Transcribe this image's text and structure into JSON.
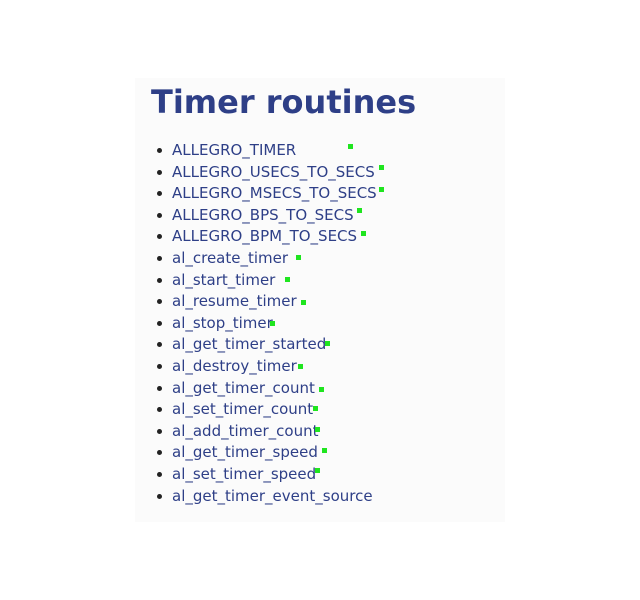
{
  "title": "Timer routines",
  "items": [
    {
      "label": "ALLEGRO_TIMER",
      "marked": true
    },
    {
      "label": "ALLEGRO_USECS_TO_SECS",
      "marked": true
    },
    {
      "label": "ALLEGRO_MSECS_TO_SECS",
      "marked": true
    },
    {
      "label": "ALLEGRO_BPS_TO_SECS",
      "marked": true
    },
    {
      "label": "ALLEGRO_BPM_TO_SECS",
      "marked": true
    },
    {
      "label": "al_create_timer",
      "marked": true
    },
    {
      "label": "al_start_timer",
      "marked": true
    },
    {
      "label": "al_resume_timer",
      "marked": true
    },
    {
      "label": "al_stop_timer",
      "marked": true
    },
    {
      "label": "al_get_timer_started",
      "marked": true
    },
    {
      "label": "al_destroy_timer",
      "marked": true
    },
    {
      "label": "al_get_timer_count",
      "marked": true
    },
    {
      "label": "al_set_timer_count",
      "marked": true
    },
    {
      "label": "al_add_timer_count",
      "marked": true
    },
    {
      "label": "al_get_timer_speed",
      "marked": true
    },
    {
      "label": "al_set_timer_speed",
      "marked": true
    },
    {
      "label": "al_get_timer_event_source",
      "marked": false
    }
  ],
  "colors": {
    "heading": "#2e3f87",
    "link": "#2e3f87",
    "marker": "#1fe51f",
    "panel_background": "#fbfbfb"
  }
}
